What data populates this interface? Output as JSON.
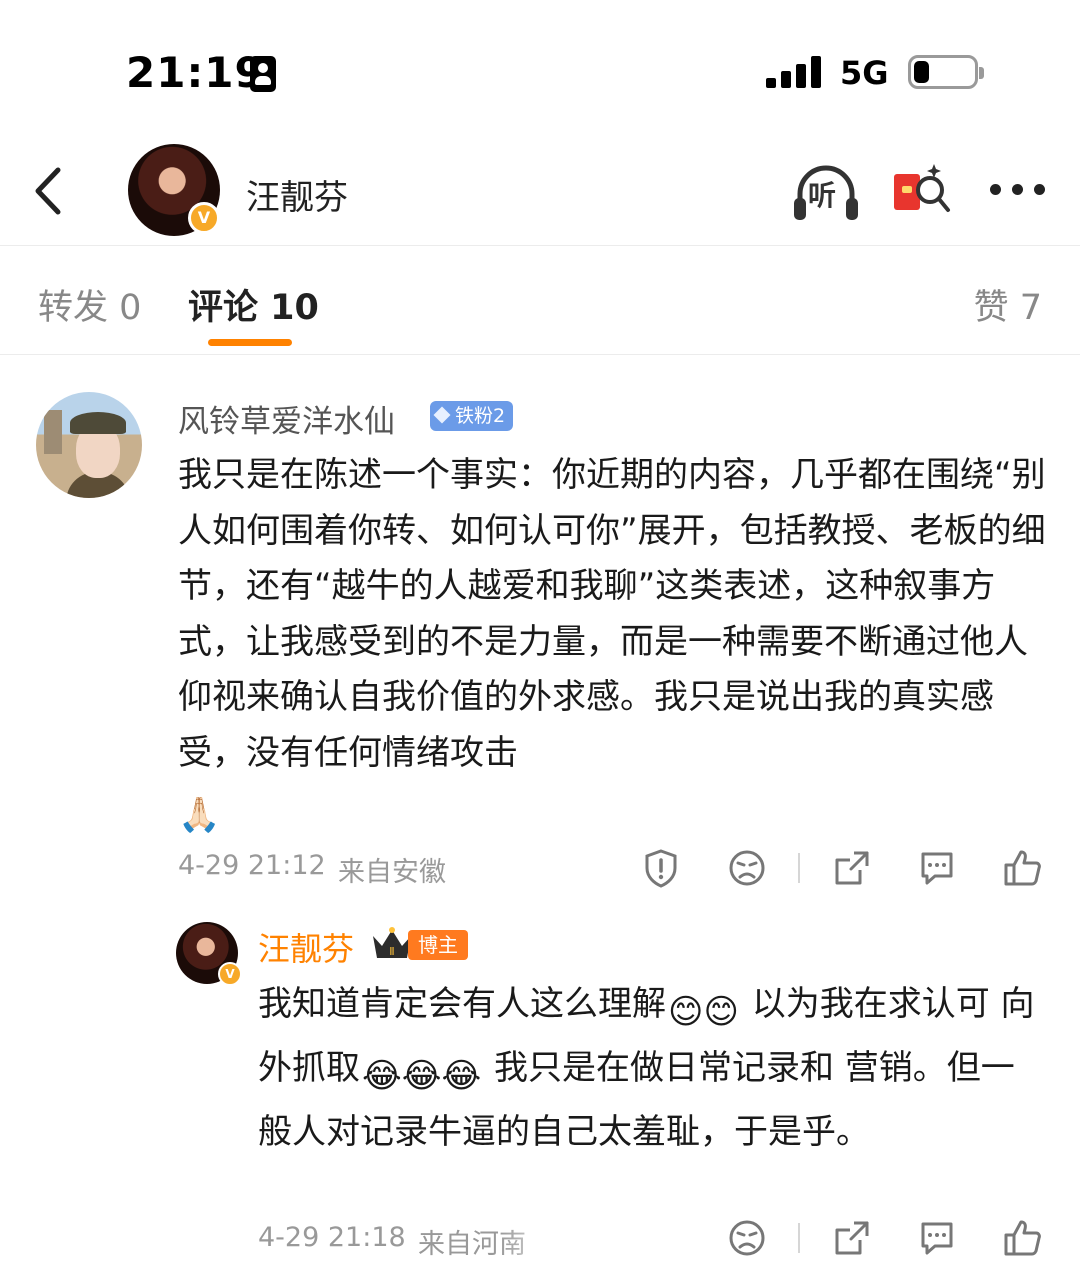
{
  "status_bar": {
    "time": "21:19",
    "network": "5G"
  },
  "header": {
    "user_name": "汪靓芬",
    "listen_label": "听",
    "verified_badge": "V"
  },
  "tabs": [
    {
      "label": "转发 0",
      "active": false
    },
    {
      "label": "评论 10",
      "active": true
    },
    {
      "label": "赞 7",
      "active": false
    }
  ],
  "comment": {
    "user": "风铃草爱洋水仙",
    "fan_badge": "铁粉2",
    "text": "我只是在陈述一个事实：你近期的内容，几乎都在围绕“别人如何围着你转、如何认可你”展开，包括教授、老板的细节，还有“越牛的人越爱和我聊”这类表述，这种叙事方式，让我感受到的不是力量，而是一种需要不断通过他人仰视来确认自我价值的外求感。我只是说出我的真实感受，没有任何情绪攻击",
    "emoji": "🙏🏻",
    "time": "4-29 21:12",
    "location": "来自安徽"
  },
  "reply": {
    "user": "汪靓芬",
    "crown_level": "Ⅱ",
    "owner_badge": "博主",
    "verified_badge": "V",
    "text_part1": "我知道肯定会有人这么理解",
    "emoji_1": "😊😊",
    "text_part2": " 以为我在求认可 向外抓取",
    "emoji_2": "😂😂😂",
    "text_part3": " 我只是在做日常记录和  营销。但一般人对记录牛逼的自己太羞耻，于是乎。",
    "time": "4-29 21:18",
    "location": "来自河南"
  },
  "colors": {
    "accent_orange": "#ff8200",
    "fan_badge_blue": "#6b9be8",
    "verified_gold": "#f7a928"
  },
  "icons": [
    "back-icon",
    "listen-icon",
    "red-packet-icon",
    "more-icon",
    "report-icon",
    "dislike-icon",
    "share-icon",
    "reply-icon",
    "like-icon"
  ]
}
